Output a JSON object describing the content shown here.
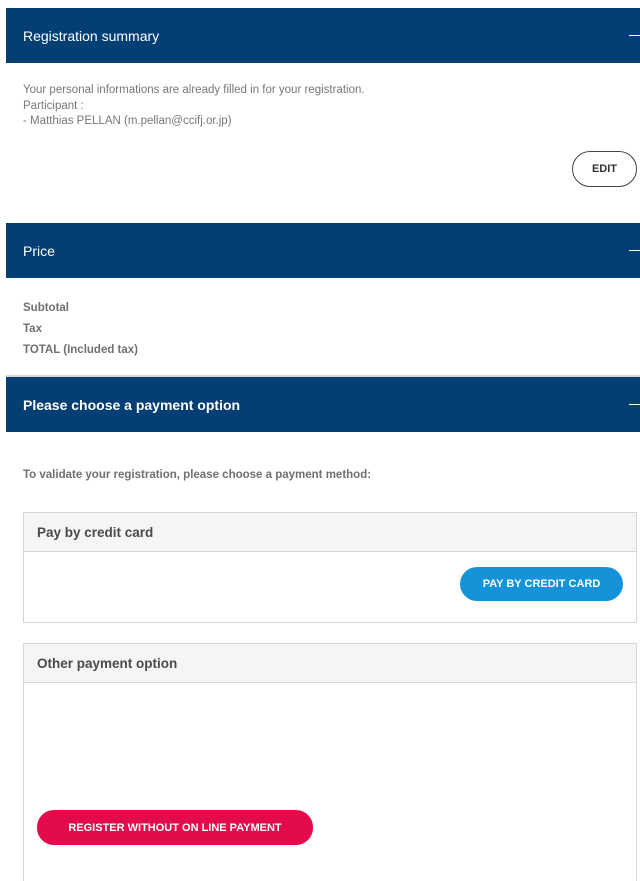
{
  "summary": {
    "title": "Registration summary",
    "line1": "Your personal informations are already filled in for your registration.",
    "line2": "Participant :",
    "line3": "- Matthias PELLAN (m.pellan@ccifj.or.jp)",
    "edit_label": "EDIT"
  },
  "price": {
    "title": "Price",
    "subtotal_label": "Subtotal",
    "tax_label": "Tax",
    "total_label": "TOTAL (Included tax)"
  },
  "payment": {
    "title": "Please choose a payment option",
    "instruction": "To validate your registration, please choose a payment method:",
    "credit_card": {
      "heading": "Pay by credit card",
      "button_label": "PAY BY CREDIT CARD"
    },
    "other": {
      "heading": "Other payment option",
      "button_label": "REGISTER WITHOUT ON LINE PAYMENT"
    }
  },
  "colors": {
    "header_bg": "#033f74",
    "credit_card_button": "#1593d9",
    "register_button": "#e30b4a"
  },
  "icons": {
    "collapse": "minus-icon"
  }
}
